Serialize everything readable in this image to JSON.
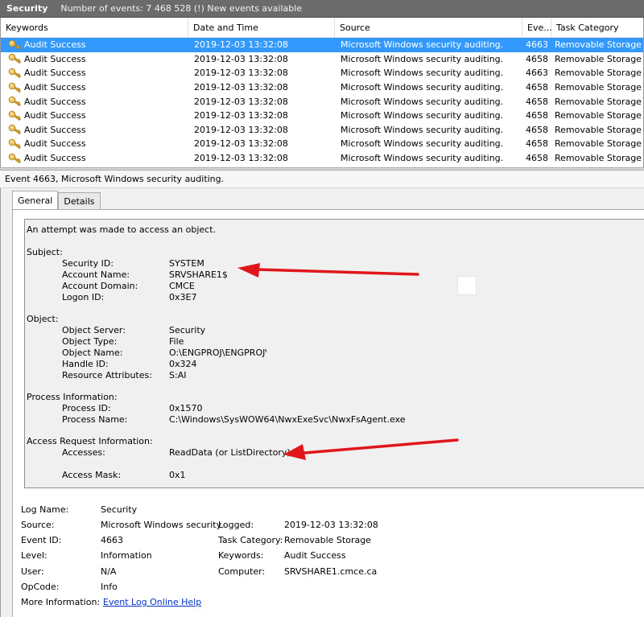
{
  "titlebar": {
    "log_name": "Security",
    "summary": "Number of events: 7 468 528 (!) New events available"
  },
  "grid": {
    "columns": [
      "Keywords",
      "Date and Time",
      "Source",
      "Eve...",
      "Task Category"
    ],
    "rows": [
      {
        "keyword": "Audit Success",
        "date": "2019-12-03 13:32:08",
        "source": "Microsoft Windows security auditing.",
        "event_id": "4663",
        "category": "Removable Storage",
        "selected": true
      },
      {
        "keyword": "Audit Success",
        "date": "2019-12-03 13:32:08",
        "source": "Microsoft Windows security auditing.",
        "event_id": "4658",
        "category": "Removable Storage"
      },
      {
        "keyword": "Audit Success",
        "date": "2019-12-03 13:32:08",
        "source": "Microsoft Windows security auditing.",
        "event_id": "4663",
        "category": "Removable Storage"
      },
      {
        "keyword": "Audit Success",
        "date": "2019-12-03 13:32:08",
        "source": "Microsoft Windows security auditing.",
        "event_id": "4658",
        "category": "Removable Storage"
      },
      {
        "keyword": "Audit Success",
        "date": "2019-12-03 13:32:08",
        "source": "Microsoft Windows security auditing.",
        "event_id": "4658",
        "category": "Removable Storage"
      },
      {
        "keyword": "Audit Success",
        "date": "2019-12-03 13:32:08",
        "source": "Microsoft Windows security auditing.",
        "event_id": "4658",
        "category": "Removable Storage"
      },
      {
        "keyword": "Audit Success",
        "date": "2019-12-03 13:32:08",
        "source": "Microsoft Windows security auditing.",
        "event_id": "4658",
        "category": "Removable Storage"
      },
      {
        "keyword": "Audit Success",
        "date": "2019-12-03 13:32:08",
        "source": "Microsoft Windows security auditing.",
        "event_id": "4658",
        "category": "Removable Storage"
      },
      {
        "keyword": "Audit Success",
        "date": "2019-12-03 13:32:08",
        "source": "Microsoft Windows security auditing.",
        "event_id": "4658",
        "category": "Removable Storage"
      }
    ],
    "icon": "key-icon"
  },
  "detail": {
    "header": "Event 4663, Microsoft Windows security auditing.",
    "tabs": [
      "General",
      "Details"
    ],
    "intro": "An attempt was made to access an object.",
    "subject": {
      "heading": "Subject:",
      "fields": [
        {
          "label": "Security ID:",
          "value": "SYSTEM"
        },
        {
          "label": "Account Name:",
          "value": "SRVSHARE1$"
        },
        {
          "label": "Account Domain:",
          "value": "CMCE"
        },
        {
          "label": "Logon ID:",
          "value": "0x3E7"
        }
      ]
    },
    "object": {
      "heading": "Object:",
      "fields": [
        {
          "label": "Object Server:",
          "value": "Security"
        },
        {
          "label": "Object Type:",
          "value": "File"
        },
        {
          "label": "Object Name:",
          "value": "O:\\ENGPROJ\\ENGPROJ\\"
        },
        {
          "label": "Handle ID:",
          "value": "0x324"
        },
        {
          "label": "Resource Attributes:",
          "value": "S:AI"
        }
      ]
    },
    "process": {
      "heading": "Process Information:",
      "fields": [
        {
          "label": "Process ID:",
          "value": "0x1570"
        },
        {
          "label": "Process Name:",
          "value": "C:\\Windows\\SysWOW64\\NwxExeSvc\\NwxFsAgent.exe"
        }
      ]
    },
    "access": {
      "heading": "Access Request Information:",
      "fields": [
        {
          "label": "Accesses:",
          "value": "ReadData (or ListDirectory)"
        },
        {
          "label": "Access Mask:",
          "value": "0x1"
        }
      ]
    },
    "meta": {
      "log_name_label": "Log Name:",
      "log_name": "Security",
      "source_label": "Source:",
      "source": "Microsoft Windows security",
      "logged_label": "Logged:",
      "logged": "2019-12-03 13:32:08",
      "event_id_label": "Event ID:",
      "event_id": "4663",
      "task_category_label": "Task Category:",
      "task_category": "Removable Storage",
      "level_label": "Level:",
      "level": "Information",
      "keywords_label": "Keywords:",
      "keywords": "Audit Success",
      "user_label": "User:",
      "user": "N/A",
      "computer_label": "Computer:",
      "computer": "SRVSHARE1.cmce.ca",
      "opcode_label": "OpCode:",
      "opcode": "Info",
      "more_info_label": "More Information:",
      "more_info_link": "Event Log Online Help"
    }
  },
  "colors": {
    "selection": "#3399ff",
    "titlebar": "#6b6b6b",
    "annotation_arrow": "#e0161b",
    "link": "#0033cc"
  }
}
